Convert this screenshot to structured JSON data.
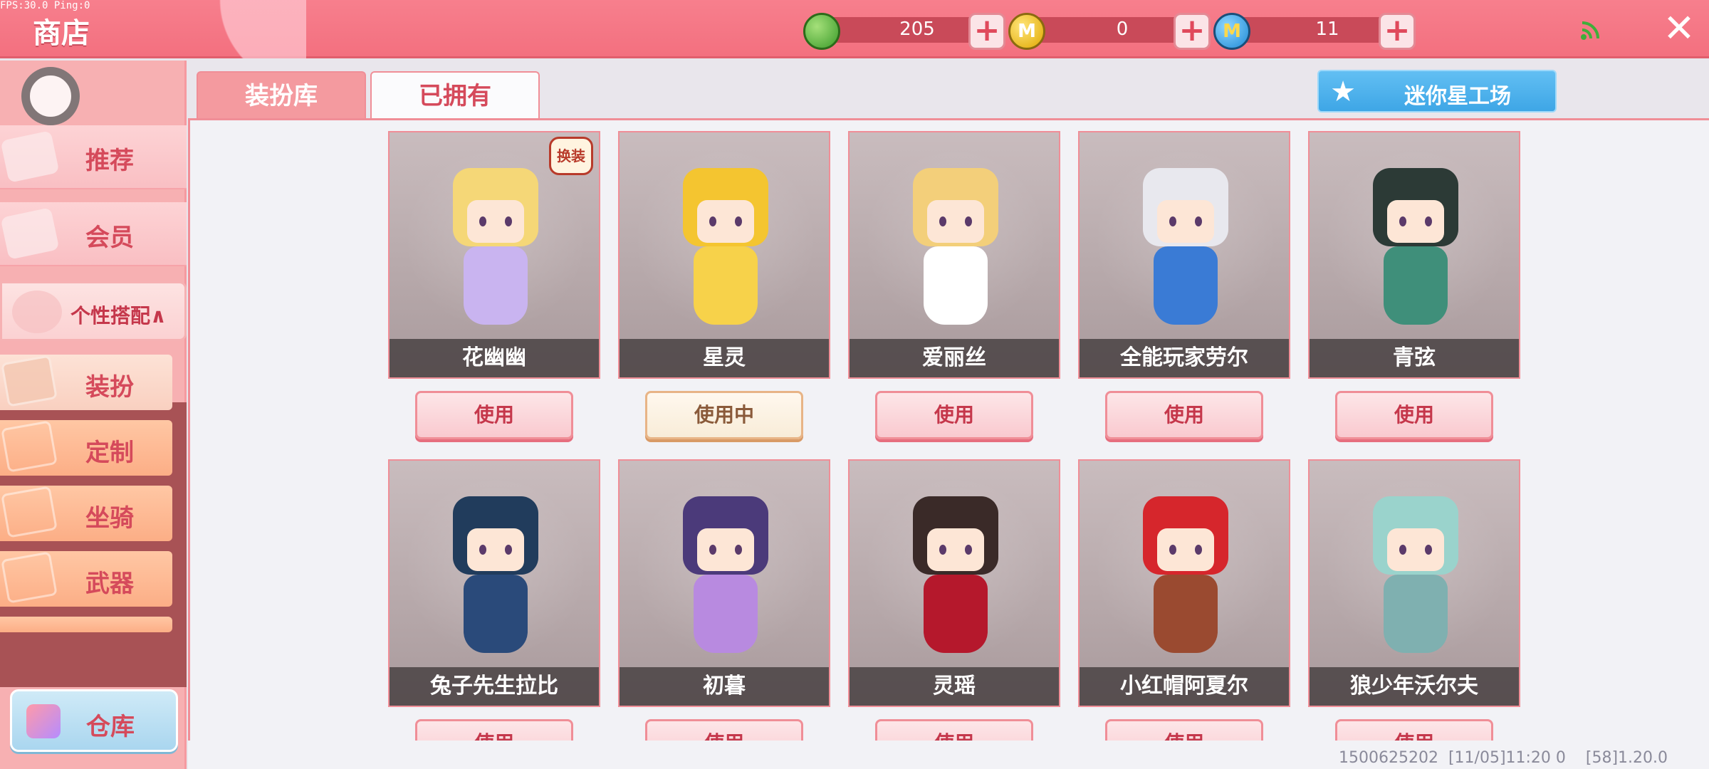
{
  "debug": {
    "fps": "FPS:30.0",
    "ping": "Ping:0"
  },
  "header": {
    "title": "商店",
    "close_icon": "close-icon",
    "signal_icon": "signal-icon"
  },
  "currencies": [
    {
      "icon": "green-gem-icon",
      "value": "205",
      "color": "#4caf50",
      "symbol": ""
    },
    {
      "icon": "gold-coin-icon",
      "value": "0",
      "color": "#f2c21b",
      "symbol": "M"
    },
    {
      "icon": "blue-coin-icon",
      "value": "11",
      "color": "#2d9fe6",
      "symbol": "M"
    }
  ],
  "sidebar": {
    "items": [
      {
        "label": "推荐",
        "icon": "thumbs-up-icon"
      },
      {
        "label": "会员",
        "icon": "vip-card-icon"
      }
    ],
    "expanded": {
      "label": "个性搭配∧",
      "icon": "outfit-icon"
    },
    "sub_items": [
      {
        "label": "装扮",
        "icon": "shirt-icon",
        "active": true
      },
      {
        "label": "定制",
        "icon": "custom-icon",
        "active": false
      },
      {
        "label": "坐骑",
        "icon": "mount-icon",
        "active": false
      },
      {
        "label": "武器",
        "icon": "weapon-icon",
        "active": false
      }
    ],
    "warehouse": {
      "label": "仓库",
      "icon": "warehouse-icon"
    }
  },
  "tabs": [
    {
      "label": "装扮库",
      "active": false
    },
    {
      "label": "已拥有",
      "active": true
    }
  ],
  "workshop": {
    "label": "迷你星工场",
    "icon": "star-icon"
  },
  "cards_row1": [
    {
      "name": "花幽幽",
      "button": "使用",
      "in_use": false,
      "hair": "#f5d777",
      "outfit": "#c9b4f0",
      "badge": "换装"
    },
    {
      "name": "星灵",
      "button": "使用中",
      "in_use": true,
      "hair": "#f4c530",
      "outfit": "#f7d24a"
    },
    {
      "name": "爱丽丝",
      "button": "使用",
      "in_use": false,
      "hair": "#f3cf7a",
      "outfit": "#ffffff"
    },
    {
      "name": "全能玩家劳尔",
      "button": "使用",
      "in_use": false,
      "hair": "#e8e8ee",
      "outfit": "#3a7bd5"
    },
    {
      "name": "青弦",
      "button": "使用",
      "in_use": false,
      "hair": "#2c3a36",
      "outfit": "#3f8f7a"
    }
  ],
  "cards_row2": [
    {
      "name": "兔子先生拉比",
      "button": "使用",
      "in_use": false,
      "hair": "#213c5c",
      "outfit": "#2a4a7a"
    },
    {
      "name": "初暮",
      "button": "使用",
      "in_use": false,
      "hair": "#4b3a7a",
      "outfit": "#b88ae0"
    },
    {
      "name": "灵瑶",
      "button": "使用",
      "in_use": false,
      "hair": "#3a2a28",
      "outfit": "#b5182c"
    },
    {
      "name": "小红帽阿夏尔",
      "button": "使用",
      "in_use": false,
      "hair": "#d6262c",
      "outfit": "#9a4a30"
    },
    {
      "name": "狼少年沃尔夫",
      "button": "使用",
      "in_use": false,
      "hair": "#9ad3cc",
      "outfit": "#7fb0b0"
    }
  ],
  "footer": {
    "info": "1500625202  [11/05]11:20 0    [58]1.20.0"
  }
}
